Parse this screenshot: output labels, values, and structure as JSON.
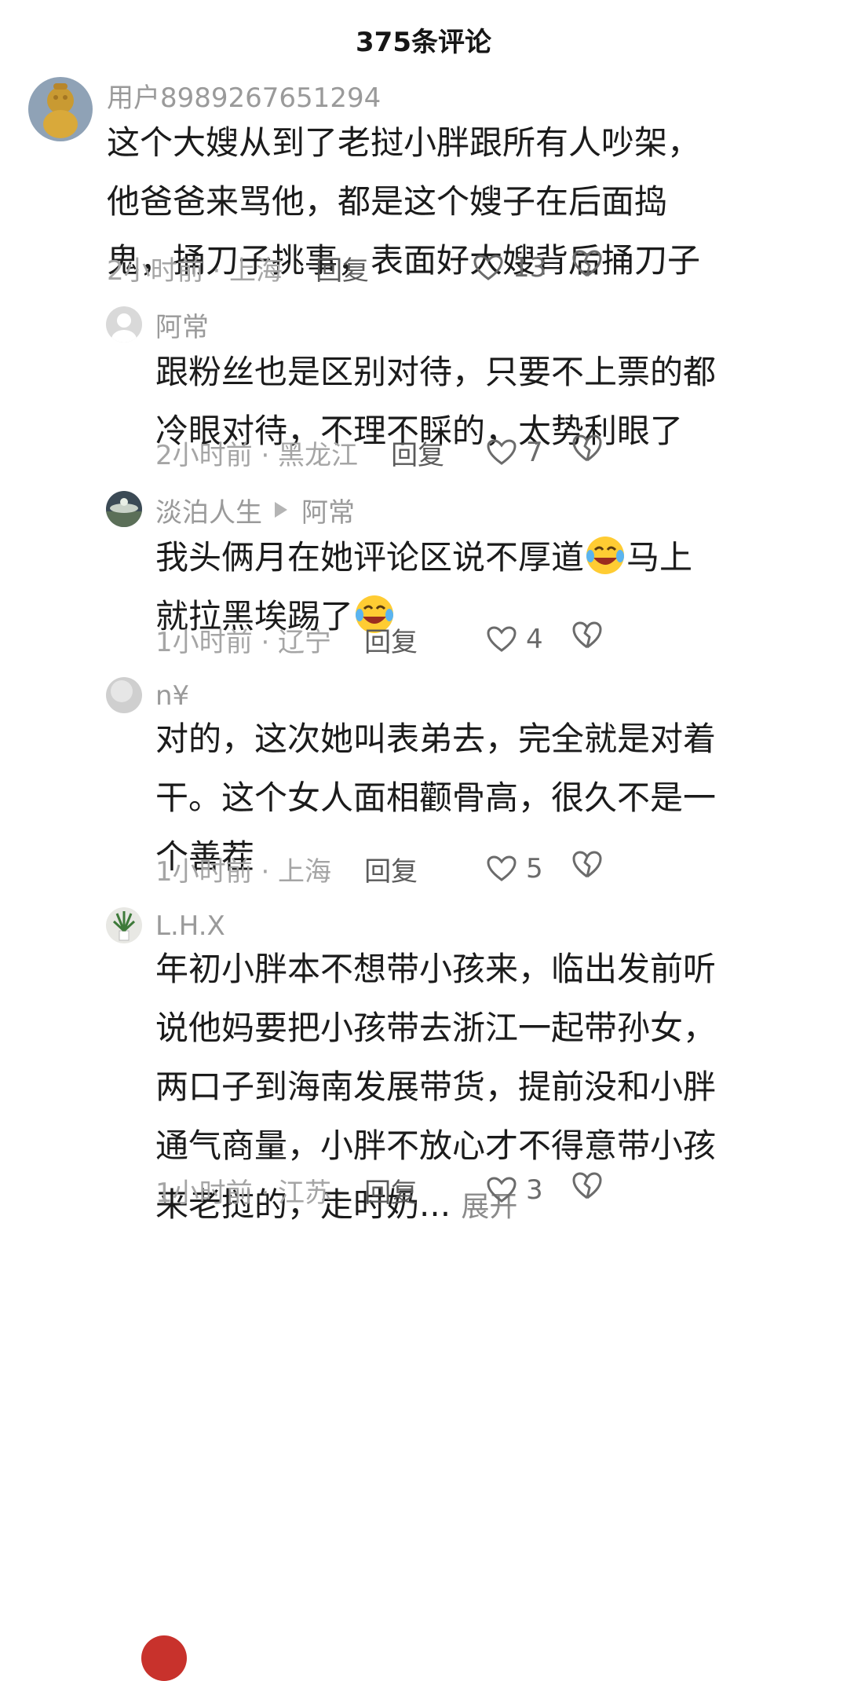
{
  "header": {
    "title": "375条评论"
  },
  "comments": [
    {
      "user": "用户8989267651294",
      "lines": [
        "这个大嫂从到了老挝小胖跟所有人吵架，",
        "他爸爸来骂他，都是这个嫂子在后面捣",
        "鬼，捅刀子挑事，表面好大嫂背后捅刀子"
      ],
      "time_location": "2小时前 · 上海",
      "reply": "回复",
      "likes": "13"
    },
    {
      "user": "阿常",
      "lines": [
        "跟粉丝也是区别对待，只要不上票的都",
        "冷眼对待，不理不睬的，太势利眼了"
      ],
      "time_location": "2小时前 · 黑龙江",
      "reply": "回复",
      "likes": "7"
    },
    {
      "user": "淡泊人生",
      "reply_to": "阿常",
      "line1a": "我头俩月在她评论区说不厚道",
      "line1b": "马上",
      "line2": "就拉黑埃踢了",
      "emoji": "rofl-emoji",
      "time_location": "1小时前 · 辽宁",
      "reply": "回复",
      "likes": "4"
    },
    {
      "user": "n¥",
      "lines": [
        "对的，这次她叫表弟去，完全就是对着",
        "干。这个女人面相颧骨高，很久不是一",
        "个善茬"
      ],
      "time_location": "1小时前 · 上海",
      "reply": "回复",
      "likes": "5"
    },
    {
      "user": "L.H.X",
      "lines": [
        "年初小胖本不想带小孩来，临出发前听",
        "说他妈要把小孩带去浙江一起带孙女，",
        "两口子到海南发展带货，提前没和小胖",
        "通气商量，小胖不放心才不得意带小孩"
      ],
      "last_line": "来老挝的，走时奶...",
      "expand": "展开",
      "time_location": "1小时前 · 江苏",
      "reply": "回复",
      "likes": "3"
    }
  ],
  "icons": {
    "like": "heart-outline-icon",
    "dislike": "broken-heart-icon"
  },
  "colors": {
    "meta": "#a5a5a5",
    "text": "#1b1b1b",
    "username": "#9a9a9a"
  }
}
